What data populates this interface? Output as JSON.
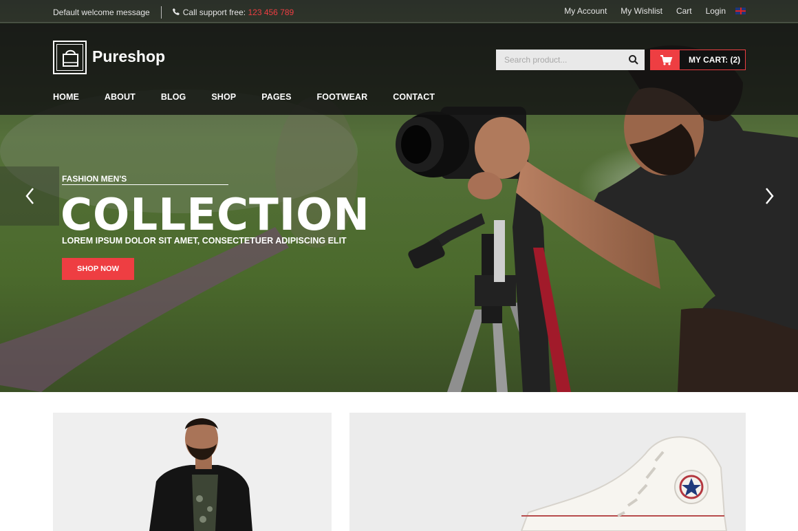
{
  "topbar": {
    "welcome": "Default welcome message",
    "support_label": "Call support free:",
    "support_number": "123 456 789",
    "links": [
      "My Account",
      "My Wishlist",
      "Cart",
      "Login"
    ],
    "language_icon": "uk-flag-icon"
  },
  "header": {
    "logo_text": "Pureshop",
    "logo_icon": "shopping-bag-icon",
    "search_placeholder": "Search product...",
    "search_icon": "search-icon",
    "cart_label": "MY CART: (2)",
    "cart_icon": "cart-icon"
  },
  "nav": {
    "items": [
      "HOME",
      "ABOUT",
      "BLOG",
      "SHOP",
      "PAGES",
      "FOOTWEAR",
      "CONTACT"
    ]
  },
  "hero": {
    "subtitle": "FASHION MEN'S",
    "title": "COLLECTION",
    "description": "LOREM IPSUM DOLOR SIT AMET, CONSECTETUER ADIPISCING ELIT",
    "button_label": "SHOP NOW",
    "prev_icon": "chevron-left-icon",
    "next_icon": "chevron-right-icon"
  },
  "colors": {
    "accent": "#ee3e42",
    "header_bg": "#141414",
    "text_light": "#ffffff"
  }
}
